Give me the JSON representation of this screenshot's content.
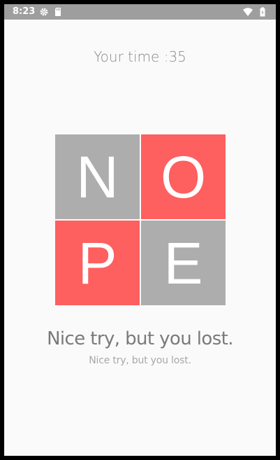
{
  "status_bar": {
    "time": "8:23",
    "left_icons": [
      "gear-icon",
      "sd-card-icon"
    ],
    "right_icons": [
      "wifi-icon",
      "battery-icon"
    ],
    "background": "#9e9e9e"
  },
  "game": {
    "time_label": "Your time :",
    "time_value": "35",
    "tiles": [
      {
        "letter": "N",
        "color": "#adadad"
      },
      {
        "letter": "O",
        "color": "#fe5f5f"
      },
      {
        "letter": "P",
        "color": "#fe5f5f"
      },
      {
        "letter": "E",
        "color": "#adadad"
      }
    ],
    "message": "Nice try, but you lost.",
    "submessage": "Nice try, but you lost."
  }
}
